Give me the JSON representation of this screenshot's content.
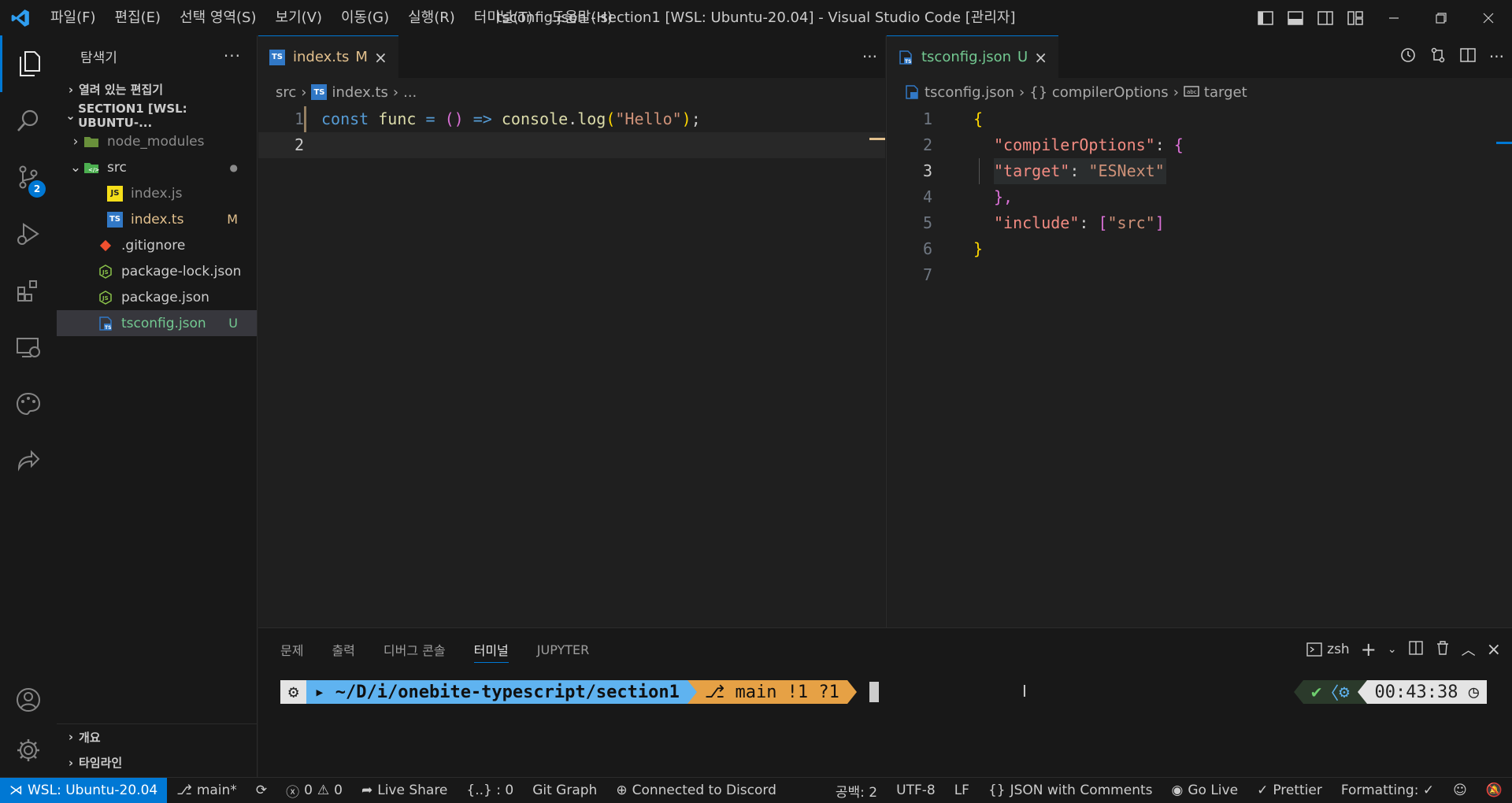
{
  "titlebar": {
    "menus": [
      "파일(F)",
      "편집(E)",
      "선택 영역(S)",
      "보기(V)",
      "이동(G)",
      "실행(R)",
      "터미널(T)",
      "도움말(H)"
    ],
    "window_title": "tsconfig.json - section1 [WSL: Ubuntu-20.04] - Visual Studio Code [관리자]"
  },
  "activity": {
    "source_control_badge": "2"
  },
  "sidebar": {
    "title": "탐색기",
    "open_editors": "열려 있는 편집기",
    "workspace": "SECTION1 [WSL: UBUNTU-...",
    "tree": [
      {
        "name": "node_modules",
        "type": "folder",
        "status": ""
      },
      {
        "name": "src",
        "type": "folder-src",
        "status": "●"
      },
      {
        "name": "index.js",
        "type": "js",
        "status": ""
      },
      {
        "name": "index.ts",
        "type": "ts",
        "status": "M"
      },
      {
        "name": ".gitignore",
        "type": "git",
        "status": ""
      },
      {
        "name": "package-lock.json",
        "type": "json",
        "status": ""
      },
      {
        "name": "package.json",
        "type": "json",
        "status": ""
      },
      {
        "name": "tsconfig.json",
        "type": "tsconfig",
        "status": "U"
      }
    ],
    "outline": "개요",
    "timeline": "타임라인"
  },
  "editor_left": {
    "tab_label": "index.ts",
    "tab_status": "M",
    "breadcrumb": [
      "src",
      "index.ts",
      "..."
    ],
    "line_numbers": [
      "1",
      "2"
    ],
    "code": {
      "kw": "const",
      "name": "func",
      "eq": "=",
      "parens": "()",
      "arrow": "=>",
      "obj": "console",
      "dot": ".",
      "method": "log",
      "open": "(",
      "str": "\"Hello\"",
      "close": ")",
      "semi": ";"
    }
  },
  "editor_right": {
    "tab_label": "tsconfig.json",
    "tab_status": "U",
    "breadcrumb": [
      "tsconfig.json",
      "{} compilerOptions",
      "target"
    ],
    "line_numbers": [
      "1",
      "2",
      "3",
      "4",
      "5",
      "6",
      "7"
    ],
    "code": {
      "open_brace": "{",
      "compiler_key": "\"compilerOptions\"",
      "colon": ":",
      "inner_open": "{",
      "target_key": "\"target\"",
      "target_val": "\"ESNext\"",
      "inner_close": "},",
      "include_key": "\"include\"",
      "arr_open": "[",
      "include_val": "\"src\"",
      "arr_close": "]",
      "close_brace": "}"
    }
  },
  "panel": {
    "tabs": [
      "문제",
      "출력",
      "디버그 콘솔",
      "터미널",
      "JUPYTER"
    ],
    "active_tab": "터미널",
    "shell": "zsh",
    "prompt_path": "~/D/i/onebite-typescript/section1",
    "prompt_git": "main !1 ?1",
    "clock": "00:43:38"
  },
  "statusbar": {
    "remote": "WSL: Ubuntu-20.04",
    "branch": "main*",
    "errors": "0",
    "warnings": "0",
    "live_share": "Live Share",
    "json_path": "{..} : 0",
    "git_graph": "Git Graph",
    "discord": "Connected to Discord",
    "spaces": "공백: 2",
    "encoding": "UTF-8",
    "eol": "LF",
    "language": "JSON with Comments",
    "go_live": "Go Live",
    "prettier": "Prettier",
    "formatting": "Formatting: ✓"
  },
  "colors": {
    "accent": "#0078d4",
    "modified": "#e2c08d",
    "untracked": "#73c991"
  }
}
